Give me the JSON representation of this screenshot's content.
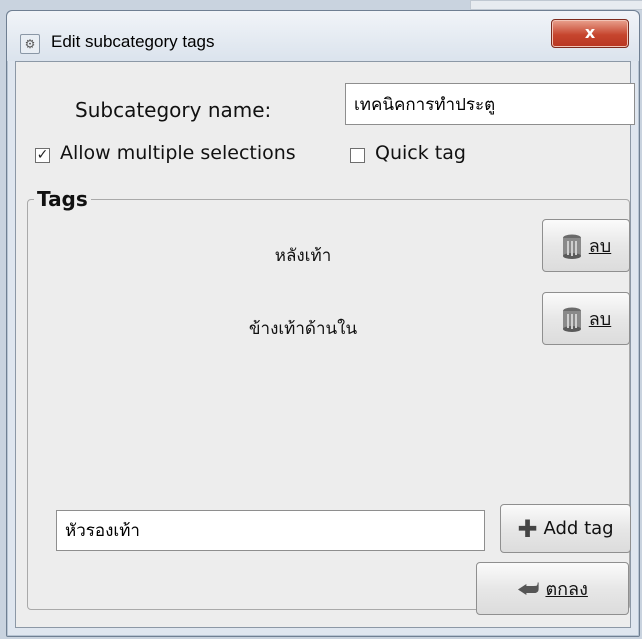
{
  "window": {
    "title": "Edit subcategory tags",
    "close_label": "x"
  },
  "form": {
    "name_label": "Subcategory name:",
    "name_value": "เทคนิคการทำประตู",
    "allow_multiple_label": "Allow multiple selections",
    "allow_multiple_checked": "✓",
    "quick_tag_label": "Quick tag"
  },
  "tags": {
    "group_label": "Tags",
    "items": [
      {
        "label": "หลังเท้า",
        "delete_label": "ลบ"
      },
      {
        "label": "ข้างเท้าด้านใน",
        "delete_label": "ลบ"
      }
    ],
    "new_tag_value": "หัวรองเท้า",
    "add_label": "Add tag"
  },
  "footer": {
    "ok_label": "ตกลง"
  }
}
